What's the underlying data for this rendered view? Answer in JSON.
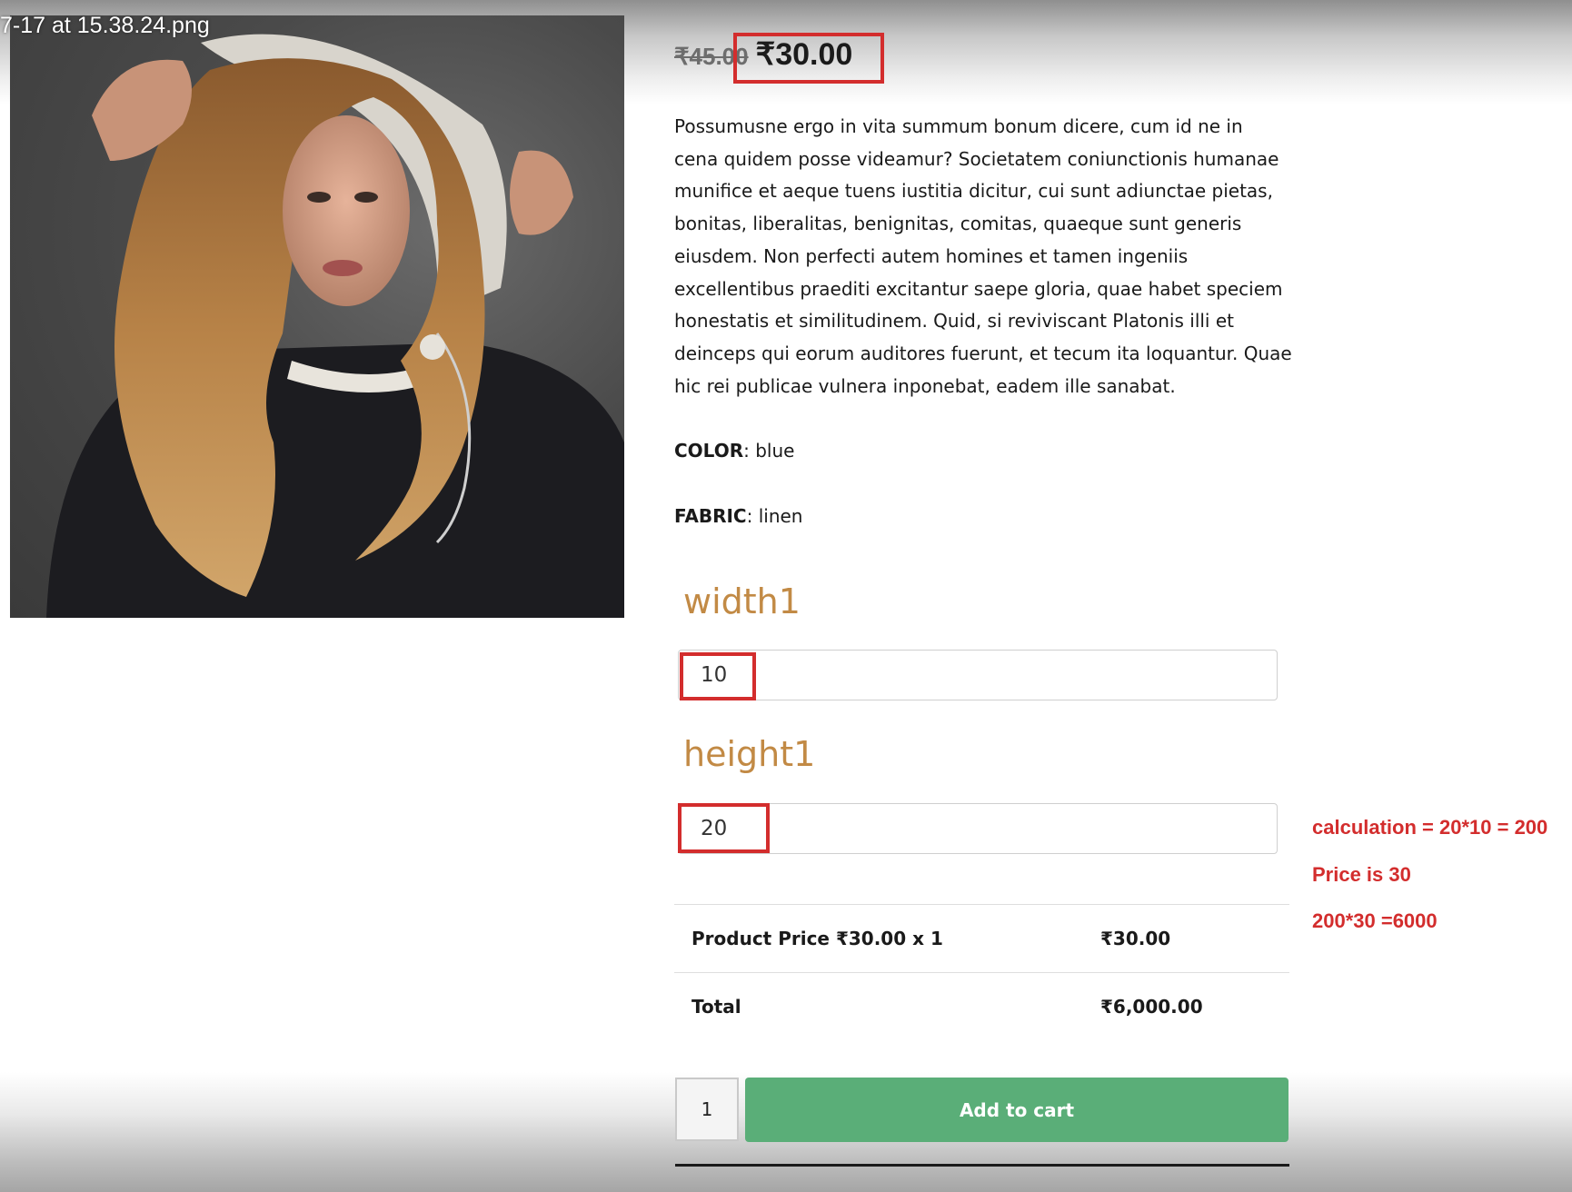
{
  "window": {
    "file_title": "7-17 at 15.38.24.png"
  },
  "product": {
    "price_old": "₹45.00",
    "price_new": "₹30.00",
    "description": "Possumusne ergo in vita summum bonum dicere, cum id ne in cena quidem posse videamur? Societatem coniunctionis humanae munifice et aeque tuens iustitia dicitur, cui sunt adiunctae pietas, bonitas, liberalitas, benignitas, comitas, quaeque sunt generis eiusdem. Non perfecti autem homines et tamen ingeniis excellentibus praediti excitantur saepe gloria, quae habet speciem honestatis et similitudinem. Quid, si reviviscant Platonis illi et deinceps qui eorum auditores fuerunt, et tecum ita loquantur. Quae hic rei publicae vulnera inponebat, eadem ille sanabat.",
    "attributes": [
      {
        "name": "COLOR",
        "value": ": blue"
      },
      {
        "name": "FABRIC",
        "value": ": linen"
      }
    ]
  },
  "fields": {
    "width": {
      "label": "width1",
      "value": "10"
    },
    "height": {
      "label": "height1",
      "value": "20"
    }
  },
  "summary": {
    "price_label": "Product Price ₹30.00 x 1",
    "price_value": "₹30.00",
    "total_label": "Total",
    "total_value": "₹6,000.00"
  },
  "cart": {
    "quantity": "1",
    "add_label": "Add to cart"
  },
  "annotations": {
    "line1": "calculation = 20*10 = 200",
    "line2": "Price is 30",
    "line3": "200*30 =6000",
    "color": "#d32d2d"
  },
  "colors": {
    "field_label": "#c28a45",
    "button": "#5aae78"
  }
}
